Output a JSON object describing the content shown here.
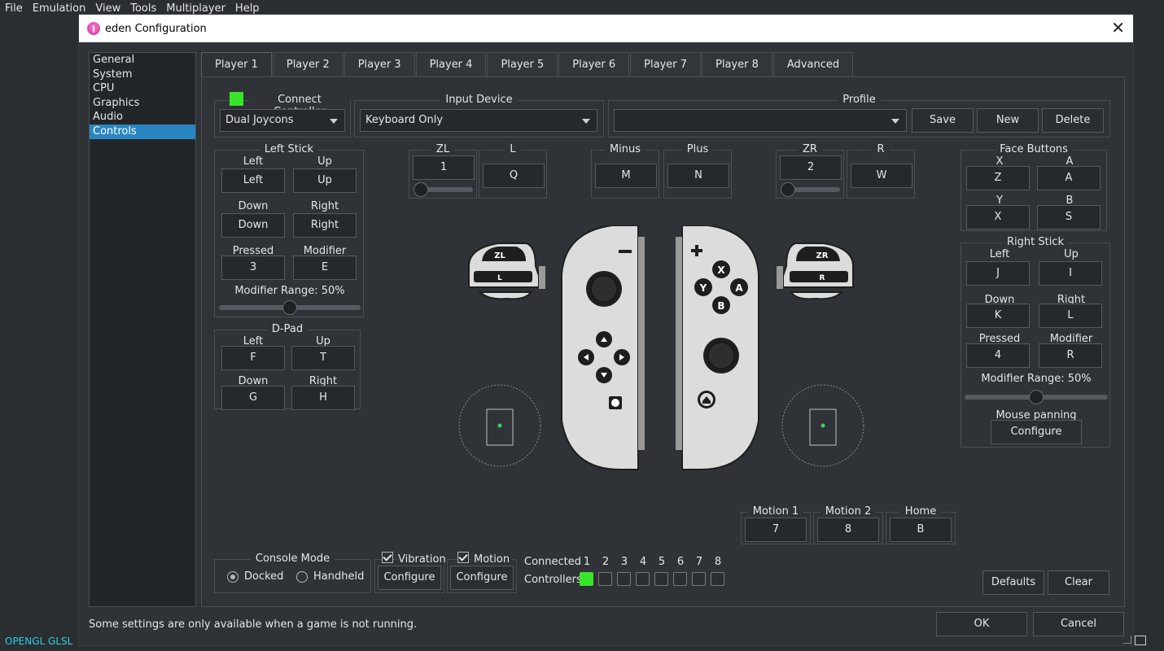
{
  "menu": [
    "File",
    "Emulation",
    "View",
    "Tools",
    "Multiplayer",
    "Help"
  ],
  "window": {
    "title": "eden Configuration",
    "close": "✕"
  },
  "nav": [
    "General",
    "System",
    "CPU",
    "Graphics",
    "Audio",
    "Controls"
  ],
  "tabs": [
    "Player 1",
    "Player 2",
    "Player 3",
    "Player 4",
    "Player 5",
    "Player 6",
    "Player 7",
    "Player 8",
    "Advanced"
  ],
  "connect_controller": {
    "label": "Connect Controller",
    "value": "Dual Joycons"
  },
  "input_device": {
    "label": "Input Device",
    "value": "Keyboard Only"
  },
  "profile": {
    "label": "Profile",
    "value": "",
    "save": "Save",
    "new": "New",
    "delete": "Delete"
  },
  "left_stick": {
    "title": "Left Stick",
    "left_lbl": "Left",
    "left": "Left",
    "up_lbl": "Up",
    "up": "Up",
    "down_lbl": "Down",
    "down": "Down",
    "right_lbl": "Right",
    "right": "Right",
    "pressed_lbl": "Pressed",
    "pressed": "3",
    "modifier_lbl": "Modifier",
    "modifier": "E",
    "range": "Modifier Range: 50%",
    "range_value": 0.5
  },
  "dpad": {
    "title": "D-Pad",
    "left_lbl": "Left",
    "left": "F",
    "up_lbl": "Up",
    "up": "T",
    "down_lbl": "Down",
    "down": "G",
    "right_lbl": "Right",
    "right": "H"
  },
  "shoulders": {
    "zl_lbl": "ZL",
    "zl": "1",
    "l_lbl": "L",
    "l": "Q",
    "minus_lbl": "Minus",
    "minus": "M",
    "plus_lbl": "Plus",
    "plus": "N",
    "zr_lbl": "ZR",
    "zr": "2",
    "r_lbl": "R",
    "r": "W"
  },
  "face": {
    "title": "Face Buttons",
    "x_lbl": "X",
    "x": "Z",
    "a_lbl": "A",
    "a": "A",
    "y_lbl": "Y",
    "y": "X",
    "b_lbl": "B",
    "b": "S"
  },
  "right_stick": {
    "title": "Right Stick",
    "left_lbl": "Left",
    "left": "J",
    "up_lbl": "Up",
    "up": "I",
    "down_lbl": "Down",
    "down": "K",
    "right_lbl": "Right",
    "right": "L",
    "pressed_lbl": "Pressed",
    "pressed": "4",
    "modifier_lbl": "Modifier",
    "modifier": "R",
    "range": "Modifier Range: 50%",
    "range_value": 0.5,
    "mouse_lbl": "Mouse panning",
    "configure": "Configure"
  },
  "diagram": {
    "zl": "ZL",
    "l": "L",
    "zr": "ZR",
    "r": "R",
    "minus": "−",
    "plus": "+",
    "x": "X",
    "y": "Y",
    "a": "A",
    "b": "B"
  },
  "motion": {
    "m1_lbl": "Motion 1",
    "m1": "7",
    "m2_lbl": "Motion 2",
    "m2": "8",
    "home_lbl": "Home",
    "home": "B"
  },
  "console_mode": {
    "title": "Console Mode",
    "docked": "Docked",
    "handheld": "Handheld",
    "selected": "Docked"
  },
  "vibration": {
    "label": "Vibration",
    "checked": true,
    "configure": "Configure"
  },
  "motion_opt": {
    "label": "Motion",
    "checked": true,
    "configure": "Configure"
  },
  "connected": {
    "line1": "Connected",
    "line2": "Controllers",
    "numbers": [
      "1",
      "2",
      "3",
      "4",
      "5",
      "6",
      "7",
      "8"
    ],
    "states": [
      true,
      false,
      false,
      false,
      false,
      false,
      false,
      false
    ]
  },
  "actions": {
    "defaults": "Defaults",
    "clear": "Clear",
    "ok": "OK",
    "cancel": "Cancel"
  },
  "status": "Some settings are only available when a game is not running.",
  "renderer": "OPENGL GLSL",
  "colors": {
    "accent": "#2a86c0",
    "led_on": "#38e52b",
    "renderer_text": "#2ad1e6"
  }
}
